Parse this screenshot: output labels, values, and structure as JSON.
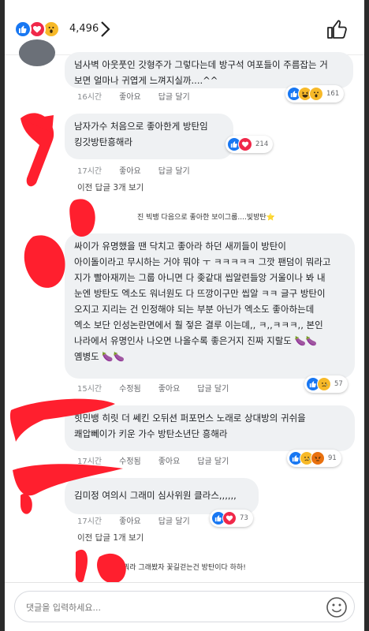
{
  "header": {
    "reaction_count": "4,496",
    "reactions": [
      "like-icon",
      "love-icon",
      "wow-icon"
    ],
    "colors": {
      "like": "#1877f2",
      "love": "#f02849",
      "wow": "#f7b928",
      "redaction": "#ff1f2e"
    }
  },
  "comments": [
    {
      "text_lines": [
        "넘사벽 아웃풋인 갓형주가 그렇다는데 방구석 여포들이 주름잡는 거",
        "보면 얼마나 귀엽게 느껴지실까....^^"
      ],
      "time": "16시간",
      "like_label": "좋아요",
      "reply_label": "답글 달기",
      "reaction_count": "161",
      "reactions": [
        "like-icon",
        "haha-icon",
        "wow-icon"
      ]
    },
    {
      "text_lines": [
        "남자가수 처음으로 좋아한게 방탄임",
        "킹갓방탄흥해라"
      ],
      "time": "17시간",
      "like_label": "좋아요",
      "reply_label": "답글 달기",
      "reaction_count": "214",
      "reactions": [
        "like-icon",
        "love-icon"
      ],
      "more_replies": "이전 답글 3개 보기",
      "reply_preview": "진 빅뱅 다음으로 좋아한 보이그룹....빛방탄⭐"
    },
    {
      "text_lines": [
        "싸이가 유명했을 땐 닥치고 좋아라 하던 새끼들이 방탄이",
        "아이돌이라고 무시하는 거야 뭐야 ㅜ ㅋㅋㅋㅋㅋ 그깟 팬덤이 뭐라고",
        "지가 빨아재끼는 그룹 아니면 다 좆같대 씹알련들앙 거울이나 봐 내",
        "눈엔 방탄도 엑소도 워너원도 다 뜨깡이구만 씹알 ㅋㅋ 글구 방탄이",
        "오지고 지리는 건 인정해야 되는 부분 아닌가 엑소도 좋아하는데",
        "엑소 보단 인성논란면에서 훨 젛은 결루 이는뎨,, ㅋ,,ㅋㅋㅋ,, 본인",
        "나라에서 유명인사 나오면 나올수록 좋은거지 진짜 지랄도 🍆🍆",
        "옘병도 🍆🍆"
      ],
      "time": "15시간",
      "edited_label": "수정됨",
      "like_label": "좋아요",
      "reply_label": "답글 달기",
      "reaction_count": "57",
      "reactions": [
        "like-icon",
        "sad-icon"
      ]
    },
    {
      "text_lines": [
        "힛민뱅 히릿 더 쎄킨 오뒤션 퍼포먼스 노래로 상대방의 귀쉬을",
        "쾌압뻬이가 키운 가수 방탄소년단 흥해라"
      ],
      "time": "17시간",
      "edited_label": "수정됨",
      "like_label": "좋아요",
      "reply_label": "답글 달기",
      "reaction_count": "91",
      "reactions": [
        "like-icon",
        "sad-icon",
        "angry-icon"
      ]
    },
    {
      "text_lines": [
        "김미정 여의시 그래미 심사위원 클라스,,,,,,"
      ],
      "time": "17시간",
      "like_label": "좋아요",
      "reply_label": "답글 달기",
      "reaction_count": "73",
      "reactions": [
        "like-icon",
        "love-icon"
      ],
      "more_replies": "이전 답글 1개 보기",
      "reply_preview": "뭐라 그래봤자 꽃길걷는건 방탄이다 하하!"
    }
  ],
  "composer": {
    "placeholder": "댓글을 입력하세요..."
  }
}
